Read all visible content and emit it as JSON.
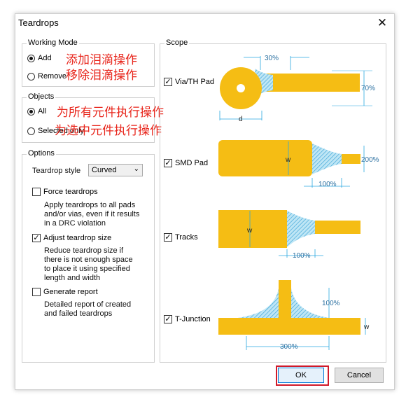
{
  "window": {
    "title": "Teardrops",
    "close_glyph": "✕"
  },
  "working_mode": {
    "title": "Working Mode",
    "options": [
      {
        "label": "Add",
        "selected": true
      },
      {
        "label": "Remove",
        "selected": false
      }
    ]
  },
  "objects": {
    "title": "Objects",
    "options": [
      {
        "label": "All",
        "selected": true
      },
      {
        "label": "Selected only",
        "selected": false
      }
    ]
  },
  "annotations": {
    "add": "添加泪滴操作",
    "remove": "移除泪滴操作",
    "all": "为所有元件执行操作",
    "selected": "为选中元件执行操作"
  },
  "options": {
    "title": "Options",
    "style_label": "Teardrop style",
    "style_value": "Curved",
    "force": {
      "label": "Force teardrops",
      "checked": false,
      "desc": [
        "Apply teardrops to all pads",
        "and/or vias, even if it results",
        "in a DRC violation"
      ]
    },
    "adjust": {
      "label": "Adjust teardrop size",
      "checked": true,
      "desc": [
        "Reduce teardrop size if",
        "there is not enough space",
        "to place it using specified",
        "length and width"
      ]
    },
    "report": {
      "label": "Generate report",
      "checked": false,
      "desc": [
        "Detailed report of created",
        "and failed teardrops"
      ]
    }
  },
  "scope": {
    "title": "Scope",
    "via": {
      "label": "Via/TH Pad",
      "checked": true,
      "len": "30%",
      "width": "70%",
      "d": "d"
    },
    "smd": {
      "label": "SMD Pad",
      "checked": true,
      "w": "w",
      "width": "200%",
      "len": "100%"
    },
    "tracks": {
      "label": "Tracks",
      "checked": true,
      "w": "w",
      "len": "100%"
    },
    "tjunction": {
      "label": "T-Junction",
      "checked": true,
      "height": "100%",
      "w": "w",
      "len": "300%"
    }
  },
  "buttons": {
    "ok": "OK",
    "cancel": "Cancel"
  },
  "colors": {
    "pad": "#f5bd14",
    "teardrop": "#6fc3e6",
    "outline": "#d01a2a",
    "dim": "#2aa7e0"
  }
}
